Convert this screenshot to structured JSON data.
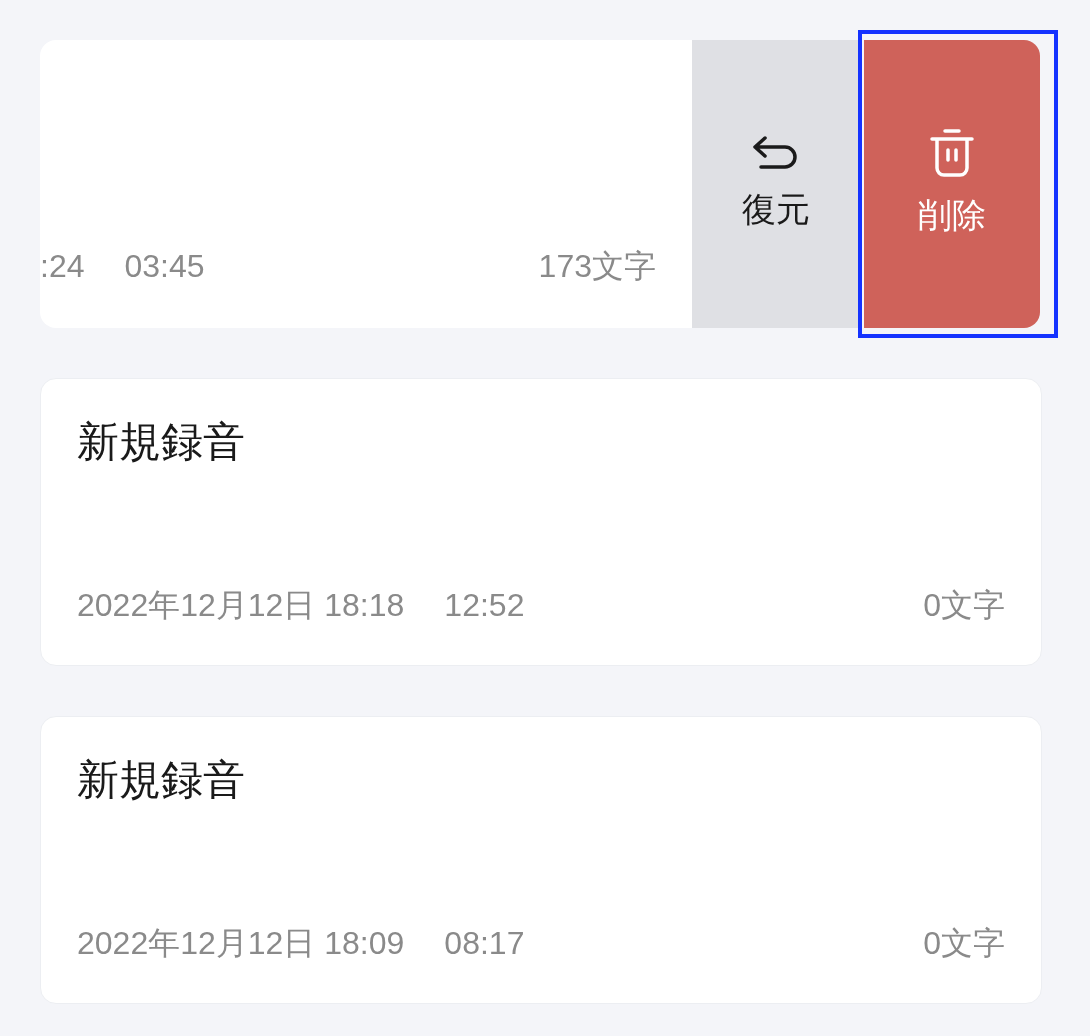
{
  "recordings": [
    {
      "kind": "swiped",
      "date": ":24",
      "duration": "03:45",
      "char_count": "173文字",
      "actions": [
        {
          "kind": "restore",
          "label": "復元",
          "highlighted": false
        },
        {
          "kind": "delete",
          "label": "削除",
          "highlighted": true
        }
      ]
    },
    {
      "kind": "normal",
      "title": "新規録音",
      "date": "2022年12月12日  18:18",
      "duration": "12:52",
      "char_count": "0文字"
    },
    {
      "kind": "normal",
      "title": "新規録音",
      "date": "2022年12月12日  18:09",
      "duration": "08:17",
      "char_count": "0文字"
    }
  ]
}
